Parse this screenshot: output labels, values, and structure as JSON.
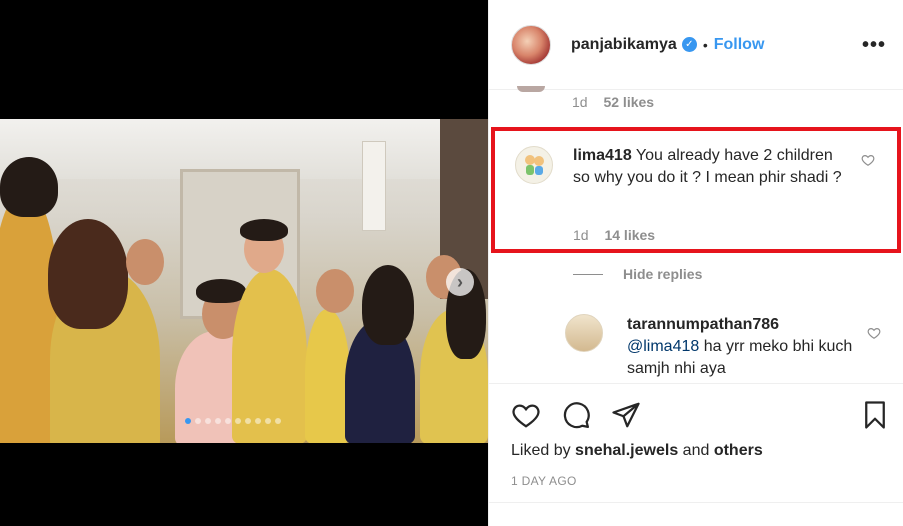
{
  "post": {
    "username": "panjabikamya",
    "separator": "•",
    "follow_label": "Follow",
    "more_label": "•••"
  },
  "previous_comment": {
    "time": "1d",
    "likes": "52 likes"
  },
  "highlighted_comment": {
    "username": "lima418",
    "text": "You already have 2 children so why you do it ? I mean phir shadi ?",
    "time": "1d",
    "likes": "14 likes"
  },
  "replies_toggle": {
    "label": "Hide replies"
  },
  "reply": {
    "username": "tarannumpathan786",
    "mention": "@lima418",
    "text": "ha yrr meko bhi kuch samjh nhi aya"
  },
  "likes_summary": {
    "prefix": "Liked by",
    "user": "snehal.jewels",
    "joiner": "and",
    "others": "others"
  },
  "timestamp": "1 DAY AGO",
  "carousel": {
    "dot_count": 10,
    "active_index": 0,
    "next_arrow": "›"
  },
  "colors": {
    "accent": "#3897f0",
    "highlight_border": "#e6141c",
    "muted": "#8e8e8e",
    "text": "#262626"
  }
}
